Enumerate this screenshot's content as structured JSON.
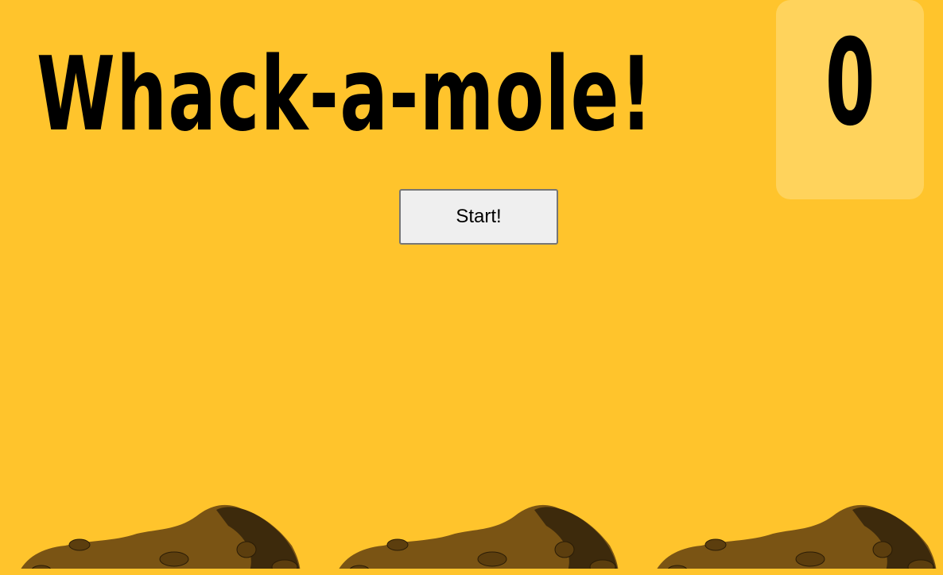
{
  "game": {
    "title": "Whack-a-mole!",
    "score": "0",
    "start_label": "Start!"
  },
  "holes": [
    {
      "id": "hole-1"
    },
    {
      "id": "hole-2"
    },
    {
      "id": "hole-3"
    }
  ],
  "colors": {
    "background": "#ffc42c",
    "score_panel": "#ffd35c",
    "dirt_light": "#7a5414",
    "dirt_dark": "#3d2a0c",
    "button_bg": "#efefef"
  }
}
